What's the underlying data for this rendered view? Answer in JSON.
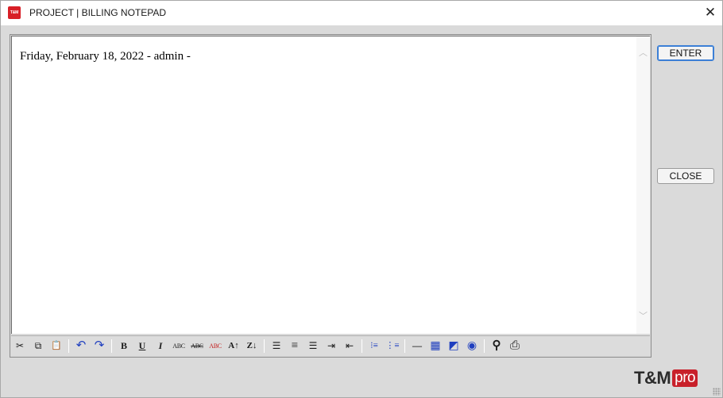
{
  "window": {
    "title": "PROJECT | BILLING NOTEPAD",
    "app_icon_text": "T&M",
    "close_glyph": "✕"
  },
  "editor": {
    "content": "Friday, February 18, 2022 - admin -",
    "scroll_up_glyph": "︿",
    "scroll_down_glyph": "﹀"
  },
  "toolbar": {
    "cut": "✂",
    "copy": "⧉",
    "paste": "📋",
    "undo": "↶",
    "redo": "↷",
    "bold": "B",
    "underline": "U",
    "italic": "I",
    "abc1": "ABC",
    "abc2": "ABC",
    "abc3": "ABC",
    "sort_asc": "A↑",
    "sort_desc": "Z↓",
    "align_left": "☰",
    "align_center": "≡",
    "align_right": "☰",
    "indent": "⇥",
    "outdent": "⇤",
    "bullets": "⁝≡",
    "numbering": "⋮≡",
    "hr": "—",
    "table": "▦",
    "image": "◩",
    "globe": "◉",
    "find": "⚲",
    "print": "⎙"
  },
  "buttons": {
    "enter": "ENTER",
    "close": "CLOSE"
  },
  "logo": {
    "brand": "T&M",
    "suffix": "pro",
    "accent_color": "#c8202a"
  }
}
